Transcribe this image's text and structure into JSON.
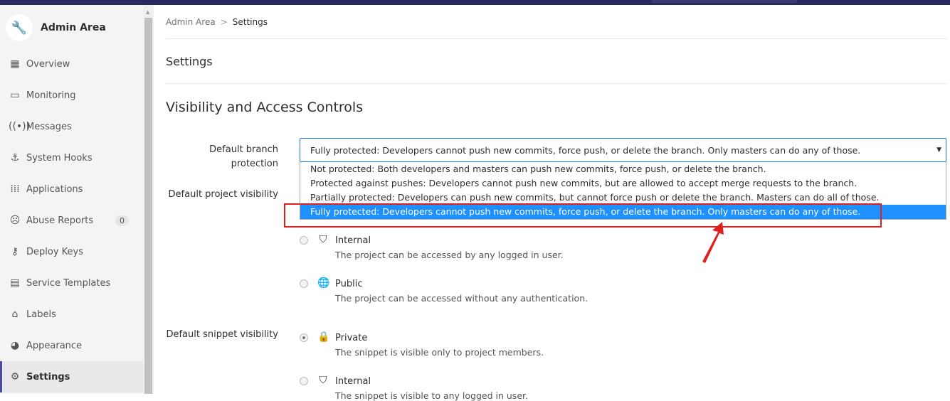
{
  "sidebar": {
    "title": "Admin Area",
    "items": [
      {
        "label": "Overview",
        "icon": "grid-icon"
      },
      {
        "label": "Monitoring",
        "icon": "monitor-icon"
      },
      {
        "label": "Messages",
        "icon": "broadcast-icon"
      },
      {
        "label": "System Hooks",
        "icon": "anchor-icon"
      },
      {
        "label": "Applications",
        "icon": "apps-icon"
      },
      {
        "label": "Abuse Reports",
        "icon": "face-icon",
        "badge": "0"
      },
      {
        "label": "Deploy Keys",
        "icon": "key-icon"
      },
      {
        "label": "Service Templates",
        "icon": "template-icon"
      },
      {
        "label": "Labels",
        "icon": "label-icon"
      },
      {
        "label": "Appearance",
        "icon": "palette-icon"
      },
      {
        "label": "Settings",
        "icon": "gear-icon",
        "active": true
      }
    ]
  },
  "breadcrumb": {
    "parent": "Admin Area",
    "current": "Settings"
  },
  "page_title": "Settings",
  "section_title": "Visibility and Access Controls",
  "branch_protection": {
    "label": "Default branch protection",
    "selected": "Fully protected: Developers cannot push new commits, force push, or delete the branch. Only masters can do any of those.",
    "options": [
      "Not protected: Both developers and masters can push new commits, force push, or delete the branch.",
      "Protected against pushes: Developers cannot push new commits, but are allowed to accept merge requests to the branch.",
      "Partially protected: Developers can push new commits, but cannot force push or delete the branch. Masters can do all of those.",
      "Fully protected: Developers cannot push new commits, force push, or delete the branch. Only masters can do any of those."
    ]
  },
  "project_visibility": {
    "label": "Default project visibility",
    "options": [
      {
        "name": "Internal",
        "desc": "The project can be accessed by any logged in user.",
        "checked": false
      },
      {
        "name": "Public",
        "desc": "The project can be accessed without any authentication.",
        "checked": false
      }
    ]
  },
  "snippet_visibility": {
    "label": "Default snippet visibility",
    "options": [
      {
        "name": "Private",
        "desc": "The snippet is visible only to project members.",
        "checked": true
      },
      {
        "name": "Internal",
        "desc": "The snippet is visible to any logged in user.",
        "checked": false
      }
    ]
  },
  "colors": {
    "accent": "#1f78d1",
    "highlight": "#e02020",
    "topbar": "#292961"
  }
}
